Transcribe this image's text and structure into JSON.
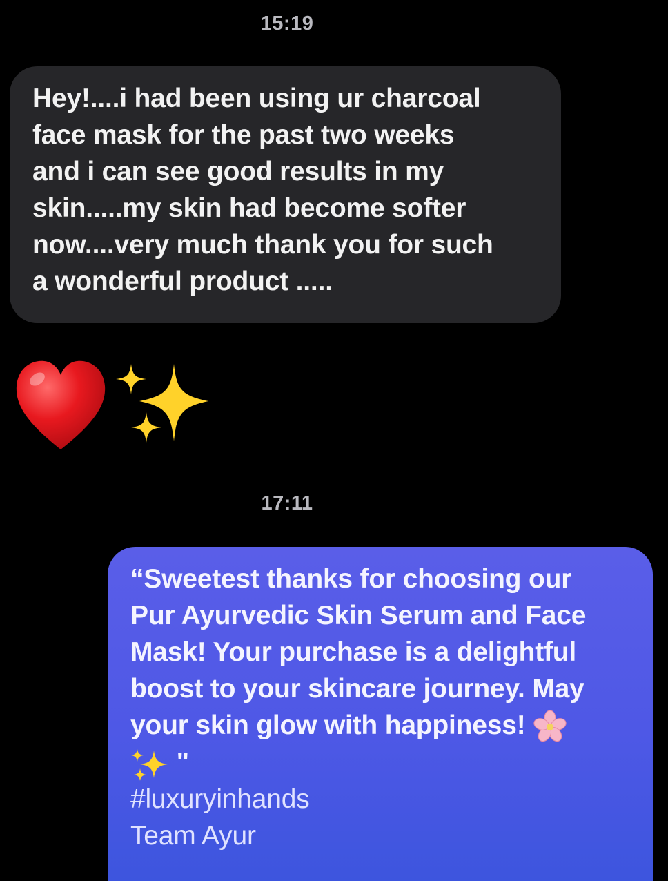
{
  "conversation": {
    "timestamp_first": "15:19",
    "incoming_message": {
      "lines": [
        "Hey!....i had been using ur charcoal",
        "face mask for the past two weeks",
        "and i can see good results in my",
        "skin.....my skin had become softer",
        "now....very much thank you for such",
        "a wonderful product ....."
      ]
    },
    "reaction": {
      "icons": [
        "red-heart-icon",
        "sparkles-icon"
      ],
      "colors": {
        "heart": "#e0151b",
        "sparkles": "#ffd22a"
      }
    },
    "timestamp_second": "17:11",
    "outgoing_message": {
      "lines": [
        "“Sweetest thanks for choosing our",
        "Pur Ayurvedic Skin Serum and Face",
        "Mask! Your purchase is a delightful",
        "boost to your skincare journey. May",
        "your skin glow with happiness!"
      ],
      "closing_quote": "\"",
      "hashtag": "#luxuryinhands",
      "signature": "Team Ayur",
      "emojis": [
        "cherry-blossom-icon",
        "sparkles-icon"
      ]
    }
  },
  "colors": {
    "background": "#000000",
    "incoming_bubble": "#262629",
    "outgoing_bubble": "#4e58e6",
    "timestamp": "#b9b9bf"
  }
}
